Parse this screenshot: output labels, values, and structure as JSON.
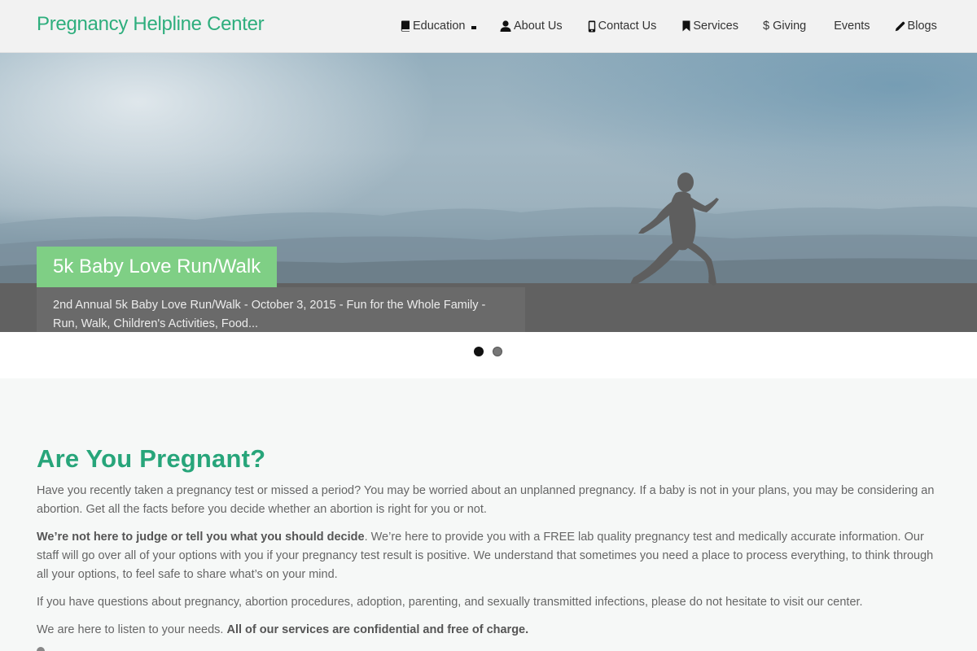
{
  "header": {
    "logo": "Pregnancy Helpline Center",
    "nav": [
      {
        "label": "Education",
        "icon": "book-icon",
        "has_dropdown": true
      },
      {
        "label": "About Us",
        "icon": "user-icon"
      },
      {
        "label": "Contact Us",
        "icon": "mobile-phone-icon"
      },
      {
        "label": "Services",
        "icon": "bookmark-icon"
      },
      {
        "label": "$ Giving",
        "icon": null
      },
      {
        "label": "Events",
        "icon": null
      },
      {
        "label": "Blogs",
        "icon": "pencil-icon"
      }
    ]
  },
  "slider": {
    "title": "5k Baby Love Run/Walk",
    "description": "2nd Annual 5k Baby Love Run/Walk - October 3, 2015 - Fun for the Whole Family - Run, Walk, Children's Activities, Food...",
    "active_slide": 1,
    "slide_count": 2
  },
  "main": {
    "heading": "Are You Pregnant?",
    "p1": "Have you recently taken a pregnancy test or missed a period? You may be worried about an unplanned pregnancy. If a baby is not in your plans, you may be considering an abortion. Get all the facts before you decide whether an abortion is right for you or not.",
    "p2_bold": "We’re not here to judge or tell you what you should decide",
    "p2_rest": ".  We’re here to provide you with a FREE lab quality pregnancy test and medically accurate information. Our staff will go over all of your options with you if your pregnancy test result is positive. We understand that sometimes you need a place to process everything, to think through all your options, to feel safe to share what’s on your mind.",
    "p3": "If you have questions about pregnancy, abortion procedures, adoption, parenting, and sexually transmitted infections, please do not hesitate to visit our center.",
    "p4_plain": "We are here to listen to your needs. ",
    "p4_bold": "All of our services are confidential and free of charge."
  },
  "colors": {
    "brand_green": "#2eae7d",
    "heading_green": "#27a57a",
    "slide_title_bg": "#7fcf85"
  }
}
